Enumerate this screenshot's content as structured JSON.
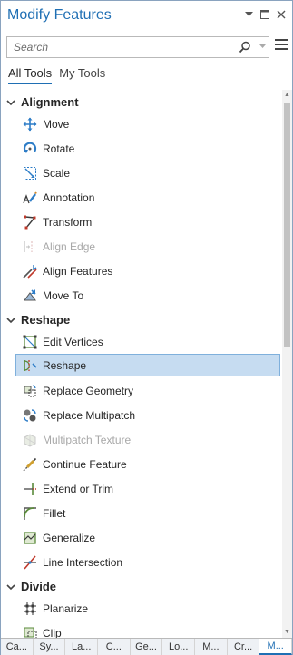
{
  "window": {
    "title": "Modify Features"
  },
  "search": {
    "placeholder": "Search"
  },
  "tabs": [
    {
      "label": "All Tools",
      "active": true
    },
    {
      "label": "My Tools",
      "active": false
    }
  ],
  "groups": [
    {
      "label": "Alignment",
      "items": [
        {
          "label": "Move",
          "icon": "move-icon"
        },
        {
          "label": "Rotate",
          "icon": "rotate-icon"
        },
        {
          "label": "Scale",
          "icon": "scale-icon"
        },
        {
          "label": "Annotation",
          "icon": "annotation-icon"
        },
        {
          "label": "Transform",
          "icon": "transform-icon"
        },
        {
          "label": "Align Edge",
          "icon": "align-edge-icon",
          "disabled": true
        },
        {
          "label": "Align Features",
          "icon": "align-features-icon"
        },
        {
          "label": "Move To",
          "icon": "move-to-icon"
        }
      ]
    },
    {
      "label": "Reshape",
      "items": [
        {
          "label": "Edit Vertices",
          "icon": "edit-vertices-icon"
        },
        {
          "label": "Reshape",
          "icon": "reshape-icon",
          "selected": true
        },
        {
          "label": "Replace Geometry",
          "icon": "replace-geometry-icon"
        },
        {
          "label": "Replace Multipatch",
          "icon": "replace-multipatch-icon"
        },
        {
          "label": "Multipatch Texture",
          "icon": "multipatch-texture-icon",
          "disabled": true
        },
        {
          "label": "Continue Feature",
          "icon": "continue-feature-icon"
        },
        {
          "label": "Extend or Trim",
          "icon": "extend-trim-icon"
        },
        {
          "label": "Fillet",
          "icon": "fillet-icon"
        },
        {
          "label": "Generalize",
          "icon": "generalize-icon"
        },
        {
          "label": "Line Intersection",
          "icon": "line-intersection-icon"
        }
      ]
    },
    {
      "label": "Divide",
      "items": [
        {
          "label": "Planarize",
          "icon": "planarize-icon"
        },
        {
          "label": "Clip",
          "icon": "clip-icon"
        }
      ]
    }
  ],
  "bottom_tabs": [
    {
      "label": "Ca..."
    },
    {
      "label": "Sy..."
    },
    {
      "label": "La..."
    },
    {
      "label": "C..."
    },
    {
      "label": "Ge..."
    },
    {
      "label": "Lo..."
    },
    {
      "label": "M..."
    },
    {
      "label": "Cr..."
    },
    {
      "label": "M...",
      "active": true
    }
  ],
  "colors": {
    "accent": "#1f6fb4",
    "selection": "#c6dcf1",
    "selection_border": "#7fb0dc",
    "disabled_text": "#a8a8a8"
  }
}
